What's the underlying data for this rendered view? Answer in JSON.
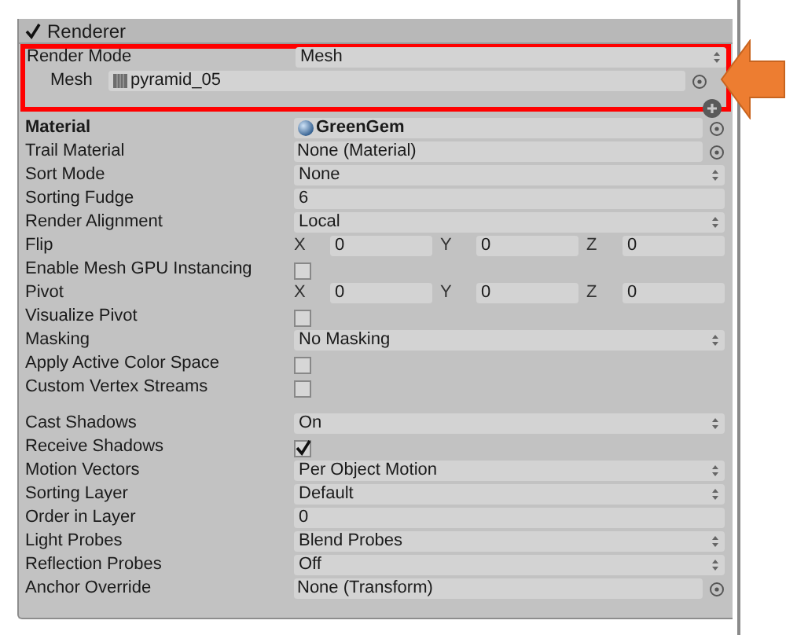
{
  "component": {
    "title": "Renderer",
    "checked": true
  },
  "groups": [
    {
      "highlighted": true,
      "rows": [
        {
          "label": "Render Mode",
          "kind": "dropdown",
          "value": "Mesh",
          "bold": false,
          "children": [
            {
              "label": "Mesh",
              "kind": "mesh_ref",
              "value": "pyramid_05",
              "bold": false
            }
          ]
        }
      ]
    },
    {
      "highlighted": false,
      "rows": [
        {
          "label": "Material",
          "kind": "material_ref",
          "value": "GreenGem",
          "bold": true
        },
        {
          "label": "Trail Material",
          "kind": "object",
          "value": "None (Material)",
          "bold": false
        },
        {
          "label": "Sort Mode",
          "kind": "dropdown",
          "value": "None",
          "bold": false
        },
        {
          "label": "Sorting Fudge",
          "kind": "text",
          "value": "6",
          "bold": false
        },
        {
          "label": "Render Alignment",
          "kind": "dropdown",
          "value": "Local",
          "bold": false
        },
        {
          "label": "Flip",
          "kind": "vector",
          "components": [
            {
              "axis": "X",
              "value": "0"
            },
            {
              "axis": "Y",
              "value": "0"
            },
            {
              "axis": "Z",
              "value": "0"
            }
          ],
          "bold": false
        },
        {
          "label": "Enable Mesh GPU Instancing",
          "kind": "checkbox",
          "checked": false,
          "bold": false
        },
        {
          "label": "Pivot",
          "kind": "vector",
          "components": [
            {
              "axis": "X",
              "value": "0"
            },
            {
              "axis": "Y",
              "value": "0"
            },
            {
              "axis": "Z",
              "value": "0"
            }
          ],
          "bold": false
        },
        {
          "label": "Visualize Pivot",
          "kind": "checkbox",
          "checked": false,
          "bold": false
        },
        {
          "label": "Masking",
          "kind": "dropdown",
          "value": "No Masking",
          "bold": false
        },
        {
          "label": "Apply Active Color Space",
          "kind": "checkbox",
          "checked": false,
          "bold": false
        },
        {
          "label": "Custom Vertex Streams",
          "kind": "checkbox",
          "checked": false,
          "bold": false
        }
      ]
    },
    {
      "highlighted": false,
      "rows": [
        {
          "label": "Cast Shadows",
          "kind": "dropdown",
          "value": "On",
          "bold": false
        },
        {
          "label": "Receive Shadows",
          "kind": "checkbox",
          "checked": true,
          "bold": false
        },
        {
          "label": "Motion Vectors",
          "kind": "dropdown",
          "value": "Per Object Motion",
          "bold": false
        },
        {
          "label": "Sorting Layer",
          "kind": "dropdown",
          "value": "Default",
          "bold": false
        },
        {
          "label": "Order in Layer",
          "kind": "text",
          "value": "0",
          "bold": false
        },
        {
          "label": "Light Probes",
          "kind": "dropdown",
          "value": "Blend Probes",
          "bold": false
        },
        {
          "label": "Reflection Probes",
          "kind": "dropdown",
          "value": "Off",
          "bold": false
        },
        {
          "label": "Anchor Override",
          "kind": "object",
          "value": "None (Transform)",
          "bold": false
        }
      ]
    }
  ]
}
